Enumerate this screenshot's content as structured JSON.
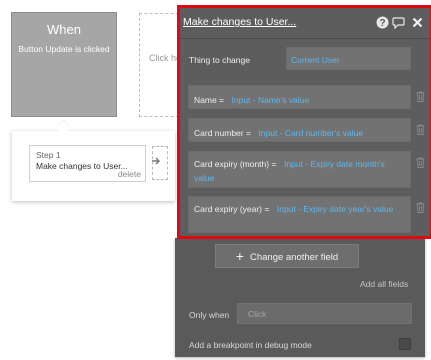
{
  "trigger": {
    "title": "When",
    "event": "Button Update is clicked"
  },
  "step": {
    "label": "Step 1",
    "name": "Make changes to User...",
    "delete_label": "delete"
  },
  "canvas": {
    "click_hint": "Click here to add an action..."
  },
  "panel": {
    "title": "Make changes to User...",
    "thing_label": "Thing to change",
    "thing_value": "Current User",
    "fields": [
      {
        "label": "Name =",
        "value": "Input - Name's value"
      },
      {
        "label": "Card number =",
        "value": "Input - Card number's value"
      },
      {
        "label": "Card expiry (month) =",
        "value": "Input - Expiry date month's value"
      },
      {
        "label": "Card expiry (year) =",
        "value": "Input - Expiry date year's value"
      }
    ],
    "add_field_label": "Change another field",
    "add_all_label": "Add all fields",
    "only_when_label": "Only when",
    "only_when_placeholder": "Click",
    "breakpoint_label": "Add a breakpoint in debug mode"
  },
  "icons": {
    "help": "help-icon",
    "comment": "comment-icon",
    "close": "close-icon",
    "delete": "trash-icon",
    "add": "plus-icon",
    "arrow": "arrow-right-icon"
  },
  "colors": {
    "highlight": "#e30613",
    "dynamic_value": "#5cb8f0",
    "panel_bg": "#5d5d5d"
  }
}
